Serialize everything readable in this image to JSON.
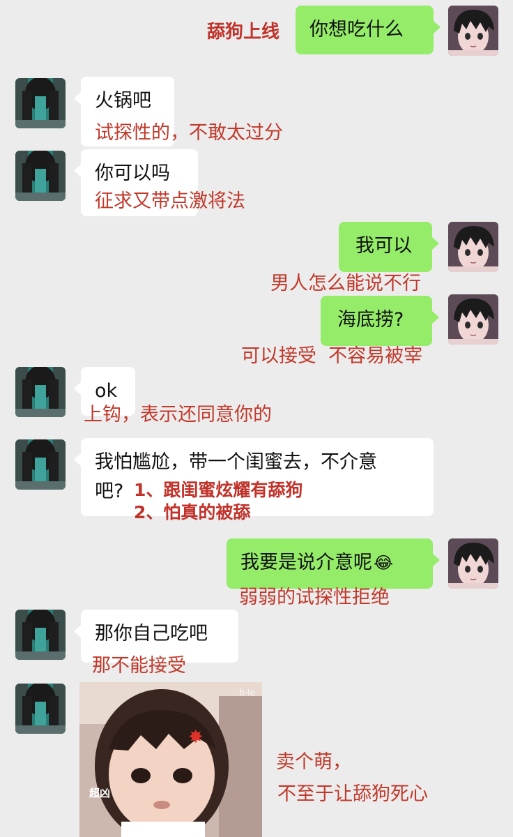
{
  "messages": [
    {
      "id": "m1",
      "side": "right",
      "text": "你想吃什么"
    },
    {
      "id": "m2",
      "side": "left",
      "text": "火锅吧"
    },
    {
      "id": "m3",
      "side": "left",
      "text": "你可以吗"
    },
    {
      "id": "m4",
      "side": "right",
      "text": "我可以"
    },
    {
      "id": "m5",
      "side": "right",
      "text": "海底捞?"
    },
    {
      "id": "m6",
      "side": "left",
      "text": "ok"
    },
    {
      "id": "m7",
      "side": "left",
      "line1": "我怕尴尬，带一个闺蜜去，不介意",
      "line2": "吧?"
    },
    {
      "id": "m8",
      "side": "right",
      "text": "我要是说介意呢",
      "emoji": "😂"
    },
    {
      "id": "m9",
      "side": "left",
      "text": "那你自己吃吧"
    }
  ],
  "annotations": {
    "a1": "舔狗上线",
    "a2": "试探性的，不敢太过分",
    "a3": "征求又带点激将法",
    "a4": "男人怎么能说不行",
    "a5": "可以接受  不容易被宰",
    "a6": "上钩，表示还同意你的",
    "a7_1": "1、跟闺蜜炫耀有舔狗",
    "a7_2": "2、怕真的被舔",
    "a8": "弱弱的试探性拒绝",
    "a9": "那不能接受",
    "a10_1": "卖个萌，",
    "a10_2": "不至于让舔狗死心"
  },
  "sticker": {
    "caption": "超凶",
    "corner_mark": "b-le",
    "icon": "anger-vein-icon"
  },
  "colors": {
    "background": "#ececec",
    "left_bubble": "#ffffff",
    "right_bubble": "#95ec69",
    "annotation": "#c0392b"
  }
}
